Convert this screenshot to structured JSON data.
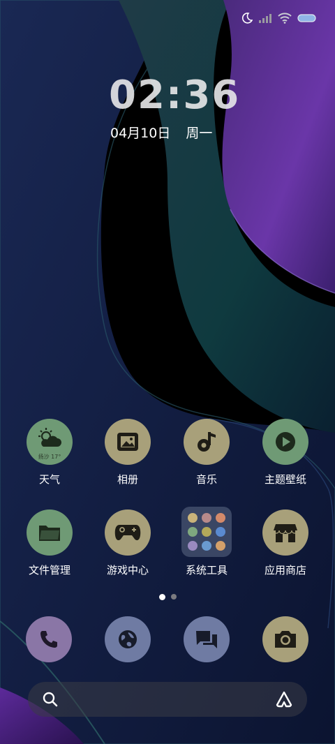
{
  "status_bar": {
    "icons": [
      "moon-icon",
      "signal-icon",
      "wifi-icon",
      "battery-icon"
    ]
  },
  "clock": {
    "time": "02:36",
    "date": "04月10日",
    "weekday": "周一"
  },
  "apps": [
    {
      "label": "天气",
      "icon": "weather-icon",
      "weather_text": "扬沙 17°",
      "color": "#6f9a75"
    },
    {
      "label": "相册",
      "icon": "gallery-icon",
      "color": "#a8a07a"
    },
    {
      "label": "音乐",
      "icon": "music-icon",
      "color": "#a8a07a"
    },
    {
      "label": "主题壁纸",
      "icon": "play-icon",
      "color": "#6f9a75"
    },
    {
      "label": "文件管理",
      "icon": "folder-icon",
      "color": "#6f9a75"
    },
    {
      "label": "游戏中心",
      "icon": "gamepad-icon",
      "color": "#a8a07a"
    },
    {
      "label": "系统工具",
      "icon": "folder-grid",
      "color": "#3a4664"
    },
    {
      "label": "应用商店",
      "icon": "store-icon",
      "color": "#a8a07a"
    }
  ],
  "page_indicator": {
    "pages": 2,
    "current": 1
  },
  "dock": [
    {
      "icon": "phone-icon",
      "color": "#8a76a6"
    },
    {
      "icon": "browser-icon",
      "color": "#6f7ba3"
    },
    {
      "icon": "messages-icon",
      "color": "#6f7ba3"
    },
    {
      "icon": "camera-icon",
      "color": "#a8a07a"
    }
  ],
  "search": {
    "icon": "search-icon",
    "assistant_icon": "assistant-icon"
  }
}
